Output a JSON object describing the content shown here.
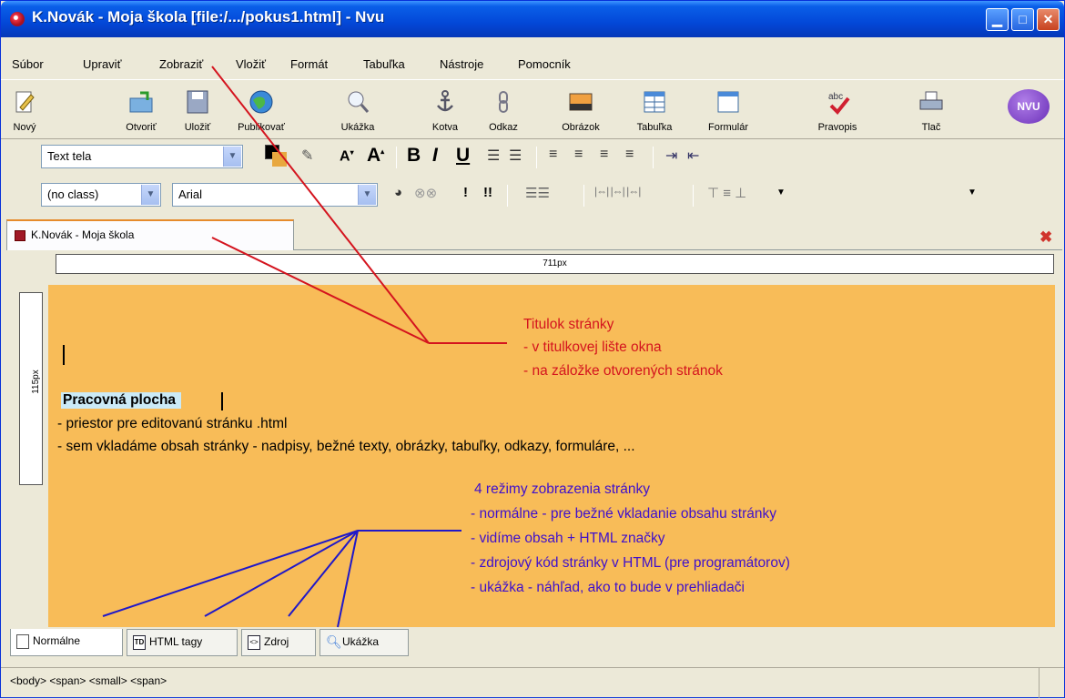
{
  "window": {
    "title": "K.Novák - Moja škola [file:/.../pokus1.html] - Nvu"
  },
  "menu": [
    "Súbor",
    "Upraviť",
    "Zobraziť",
    "Vložiť",
    "Formát",
    "Tabuľka",
    "Nástroje",
    "Pomocník"
  ],
  "toolbar": {
    "new": "Nový",
    "open": "Otvoriť",
    "save": "Uložiť",
    "publish": "Publikovať",
    "preview": "Ukážka",
    "anchor": "Kotva",
    "link": "Odkaz",
    "image": "Obrázok",
    "table": "Tabuľka",
    "form": "Formulár",
    "spell": "Pravopis",
    "print": "Tlač"
  },
  "format_bar": {
    "paragraph_style": "Text tela",
    "class": "(no class)",
    "font": "Arial",
    "bold": "B",
    "italic": "I",
    "underline": "U"
  },
  "tab": {
    "label": "K.Novák - Moja škola"
  },
  "rulers": {
    "width_label": "711px",
    "height_label": "115px"
  },
  "annotations": {
    "title_note": {
      "heading": "Titulok stránky",
      "line1": "- v titulkovej lište okna",
      "line2": "- na záložke otvorených stránok"
    },
    "workspace": {
      "heading": "Pracovná plocha",
      "line1": "- priestor pre editovanú stránku .html",
      "line2": "- sem vkladáme obsah stránky  - nadpisy, bežné texty, obrázky, tabuľky, odkazy, formuláre, ..."
    },
    "modes_note": {
      "heading": "4 režimy zobrazenia stránky",
      "line1": "- normálne - pre bežné vkladanie obsahu stránky",
      "line2": "- vidíme obsah + HTML značky",
      "line3": "- zdrojový kód stránky v HTML (pre programátorov)",
      "line4": "- ukážka - náhľad, ako to bude v prehliadači"
    }
  },
  "mode_tabs": {
    "normal": "Normálne",
    "html_tags": "HTML tagy",
    "source": "Zdroj",
    "preview": "Ukážka"
  },
  "status": {
    "path": "<body>  <span>  <small>  <span>"
  },
  "colors": {
    "canvas_bg": "#f8bc58",
    "title_note_color": "#d4141e",
    "modes_note_color": "#3f10cc",
    "title_bar": "#0348d8"
  }
}
